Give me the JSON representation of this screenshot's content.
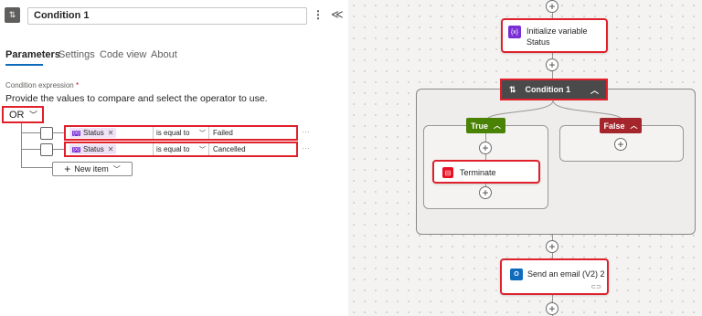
{
  "panel": {
    "title": "Condition 1",
    "kebab": "⋮",
    "collapse": "≪",
    "tabs": [
      "Parameters",
      "Settings",
      "Code view",
      "About"
    ],
    "condition_label": "Condition expression",
    "required_mark": "*",
    "description": "Provide the values to compare and select the operator to use.",
    "operator": "OR",
    "rows": [
      {
        "token": "Status",
        "token_icon": "{x}",
        "operator": "is equal to",
        "value": "Failed"
      },
      {
        "token": "Status",
        "token_icon": "{x}",
        "operator": "is equal to",
        "value": "Cancelled"
      }
    ],
    "new_item": "New item",
    "more": "···"
  },
  "canvas": {
    "init_var": {
      "icon": "{x}",
      "title_line1": "Initialize variable",
      "title_line2": "Status"
    },
    "condition": {
      "title": "Condition 1"
    },
    "true_branch": {
      "label": "True"
    },
    "false_branch": {
      "label": "False"
    },
    "terminate": {
      "title": "Terminate"
    },
    "send_email": {
      "title": "Send an email (V2) 2"
    }
  },
  "colors": {
    "highlight": "#e0202b",
    "true": "#498205",
    "false": "#a4262c",
    "variable": "#7a2ed6",
    "terminate": "#e81123",
    "outlook": "#0f6cbd"
  }
}
